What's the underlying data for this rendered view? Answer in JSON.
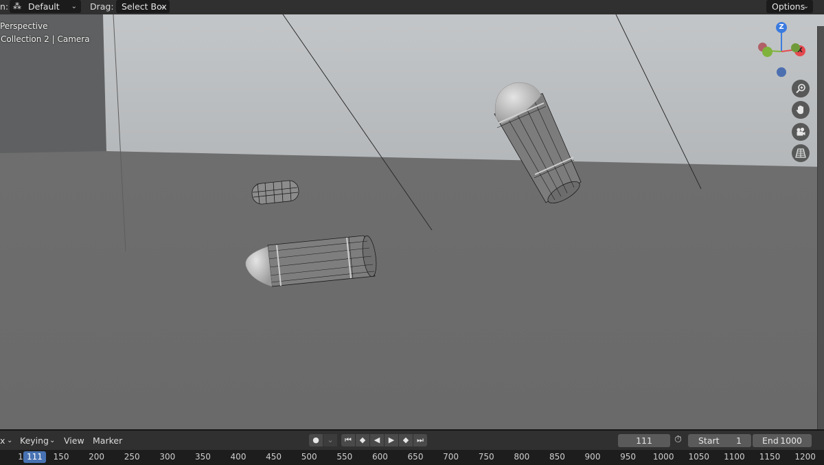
{
  "header": {
    "orientation_label_fragment": "n:",
    "orientation_value": "Default",
    "drag_label": "Drag:",
    "drag_value": "Select Box",
    "options_label": "Options"
  },
  "viewport": {
    "view_name": "Perspective",
    "collection_info": "Collection 2 | Camera",
    "gizmo": {
      "z_label": "Z",
      "x_label": "X"
    },
    "colors": {
      "x_axis": "#e5484d",
      "y_axis": "#7fb33c",
      "z_axis": "#3a7be0"
    },
    "nav_icons": [
      "zoom-icon",
      "hand-icon",
      "camera-icon",
      "grid-icon"
    ]
  },
  "timeline": {
    "menu_fragment": "x",
    "keying_label": "Keying",
    "view_label": "View",
    "marker_label": "Marker",
    "current_frame": "111",
    "start_label": "Start",
    "start_value": "1",
    "end_label": "End",
    "end_value": "1000",
    "playback_icons": [
      "record-icon",
      "jump-start-icon",
      "prev-keyframe-icon",
      "play-reverse-icon",
      "play-icon",
      "next-keyframe-icon",
      "jump-end-icon"
    ],
    "ruler": {
      "first_frame": "1",
      "current_frame": "111",
      "ticks": [
        "150",
        "200",
        "250",
        "300",
        "350",
        "400",
        "450",
        "500",
        "550",
        "600",
        "650",
        "700",
        "750",
        "800",
        "850",
        "900",
        "950",
        "1000",
        "1050",
        "1100",
        "1150",
        "1200"
      ]
    }
  }
}
